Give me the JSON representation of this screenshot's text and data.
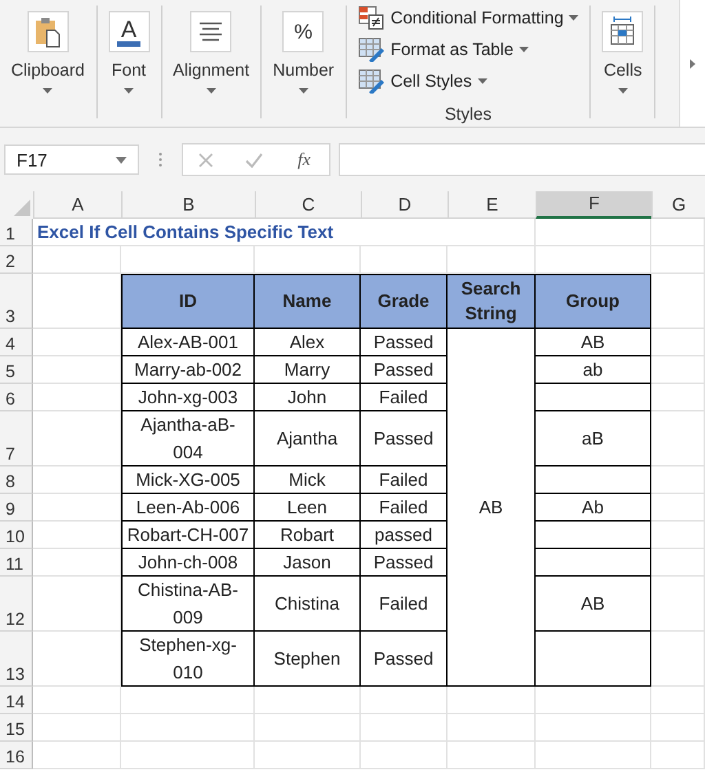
{
  "ribbon": {
    "groups": [
      {
        "kind": "clipboard",
        "label": "Clipboard"
      },
      {
        "kind": "font",
        "label": "Font",
        "glyph": "A"
      },
      {
        "kind": "alignment",
        "label": "Alignment"
      },
      {
        "kind": "number",
        "label": "Number",
        "glyph": "%"
      },
      {
        "kind": "styles",
        "label": "Styles",
        "items": [
          {
            "kind": "conditional",
            "label": "Conditional Formatting"
          },
          {
            "kind": "table",
            "label": "Format as Table"
          },
          {
            "kind": "cellstyles",
            "label": "Cell Styles"
          }
        ]
      },
      {
        "kind": "cells",
        "label": "Cells"
      }
    ]
  },
  "formula_bar": {
    "name_box": "F17",
    "function_button": "fx"
  },
  "columns": [
    {
      "label": "A",
      "selected": false
    },
    {
      "label": "B",
      "selected": false
    },
    {
      "label": "C",
      "selected": false
    },
    {
      "label": "D",
      "selected": false
    },
    {
      "label": "E",
      "selected": false
    },
    {
      "label": "F",
      "selected": true
    },
    {
      "label": "G",
      "selected": false
    }
  ],
  "rows": [
    "1",
    "2",
    "3",
    "4",
    "5",
    "6",
    "7",
    "8",
    "9",
    "10",
    "11",
    "12",
    "13",
    "14",
    "15",
    "16"
  ],
  "title": "Excel If Cell Contains Specific Text",
  "table": {
    "columns": [
      "ID",
      "Name",
      "Grade",
      "Search String",
      "Group"
    ],
    "search_string": "AB",
    "rows": [
      {
        "id": "Alex-AB-001",
        "name": "Alex",
        "grade": "Passed",
        "group": "AB"
      },
      {
        "id": "Marry-ab-002",
        "name": "Marry",
        "grade": "Passed",
        "group": "ab"
      },
      {
        "id": "John-xg-003",
        "name": "John",
        "grade": "Failed",
        "group": ""
      },
      {
        "id": "Ajantha-aB-004",
        "name": "Ajantha",
        "grade": "Passed",
        "group": "aB"
      },
      {
        "id": "Mick-XG-005",
        "name": "Mick",
        "grade": "Failed",
        "group": ""
      },
      {
        "id": "Leen-Ab-006",
        "name": "Leen",
        "grade": "Failed",
        "group": "Ab"
      },
      {
        "id": "Robart-CH-007",
        "name": "Robart",
        "grade": "passed",
        "group": ""
      },
      {
        "id": "John-ch-008",
        "name": "Jason",
        "grade": "Passed",
        "group": ""
      },
      {
        "id": "Chistina-AB-009",
        "name": "Chistina",
        "grade": "Failed",
        "group": "AB"
      },
      {
        "id": "Stephen-xg-010",
        "name": "Stephen",
        "grade": "Passed",
        "group": ""
      }
    ]
  }
}
